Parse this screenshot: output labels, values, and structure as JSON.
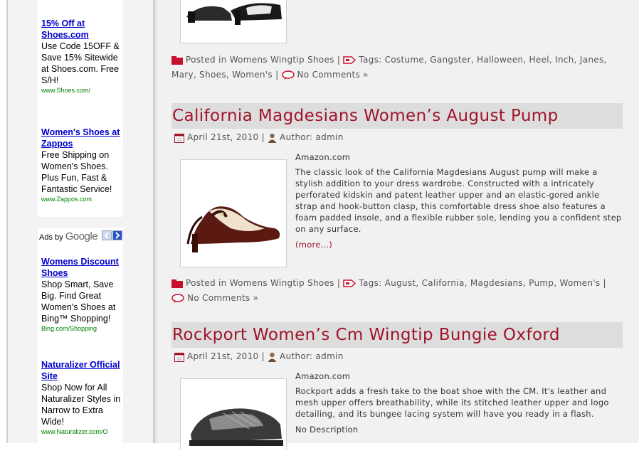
{
  "sidebar": {
    "ads_block_1": [
      {
        "title": "15% Off at Shoes.com",
        "text": "Use Code 15OFF & Save 15% Sitewide at Shoes.com. Free S/H!",
        "url": "www.Shoes.com/"
      },
      {
        "title": "Women's Shoes at Zappos",
        "text": "Free Shipping on Women's Shoes. Plus Fun, Fast & Fantastic Service!",
        "url": "www.Zappos.com"
      }
    ],
    "ads_by_label": "Ads by",
    "ads_by_brand": "Google",
    "ads_block_2": [
      {
        "title": "Womens Discount Shoes",
        "text": "Shop Smart, Save Big. Find Great Women's Shoes at Bing™ Shopping!",
        "url": "Bing.com/Shopping"
      },
      {
        "title": "Naturalizer Official Site",
        "text": "Shop Now for All Naturalizer Styles in Narrow to Extra Wide!",
        "url": "www.Naturalizer.com/O"
      }
    ]
  },
  "post_top_meta": {
    "posted_in_label": "Posted in",
    "category": "Womens Wingtip Shoes",
    "tags_label": "Tags:",
    "tags": "Costume, Gangster, Halloween, Heel, Inch, Janes, Mary, Shoes, Women's",
    "comments": "No Comments »"
  },
  "posts": [
    {
      "title": "California Magdesians Women’s August Pump",
      "date": "April 21st, 2010",
      "author_label": "Author:",
      "author": "admin",
      "source": "Amazon.com",
      "excerpt": "The classic look of the California Magdesians August pump will make a stylish addition to your dress wardrobe. Constructed with a intricately perforated kidskin and patent leather upper and an elastic-gored ankle strap and hook-button clasp, this comfortable dress shoe also features a foam padded insole, and a flexible rubber sole, lending you a confident step on any surface.",
      "more": "(more…)",
      "posted_in_label": "Posted in",
      "category": "Womens Wingtip Shoes",
      "tags_label": "Tags:",
      "tags": "August, California, Magdesians, Pump, Women's",
      "comments": "No Comments »"
    },
    {
      "title": "Rockport Women’s Cm Wingtip Bungie Oxford",
      "date": "April 21st, 2010",
      "author_label": "Author:",
      "author": "admin",
      "source": "Amazon.com",
      "excerpt": "Rockport adds a fresh take to the boat shoe with the CM. It's leather and mesh upper offers breathability, while its stitched leather upper and logo detailing, and its bungee lacing system will have you ready in a flash.",
      "no_description": "No Description"
    }
  ],
  "colors": {
    "title": "#a0142a",
    "title_bg": "#dddddd",
    "ad_link": "#0000cc",
    "ad_url": "#008000"
  }
}
